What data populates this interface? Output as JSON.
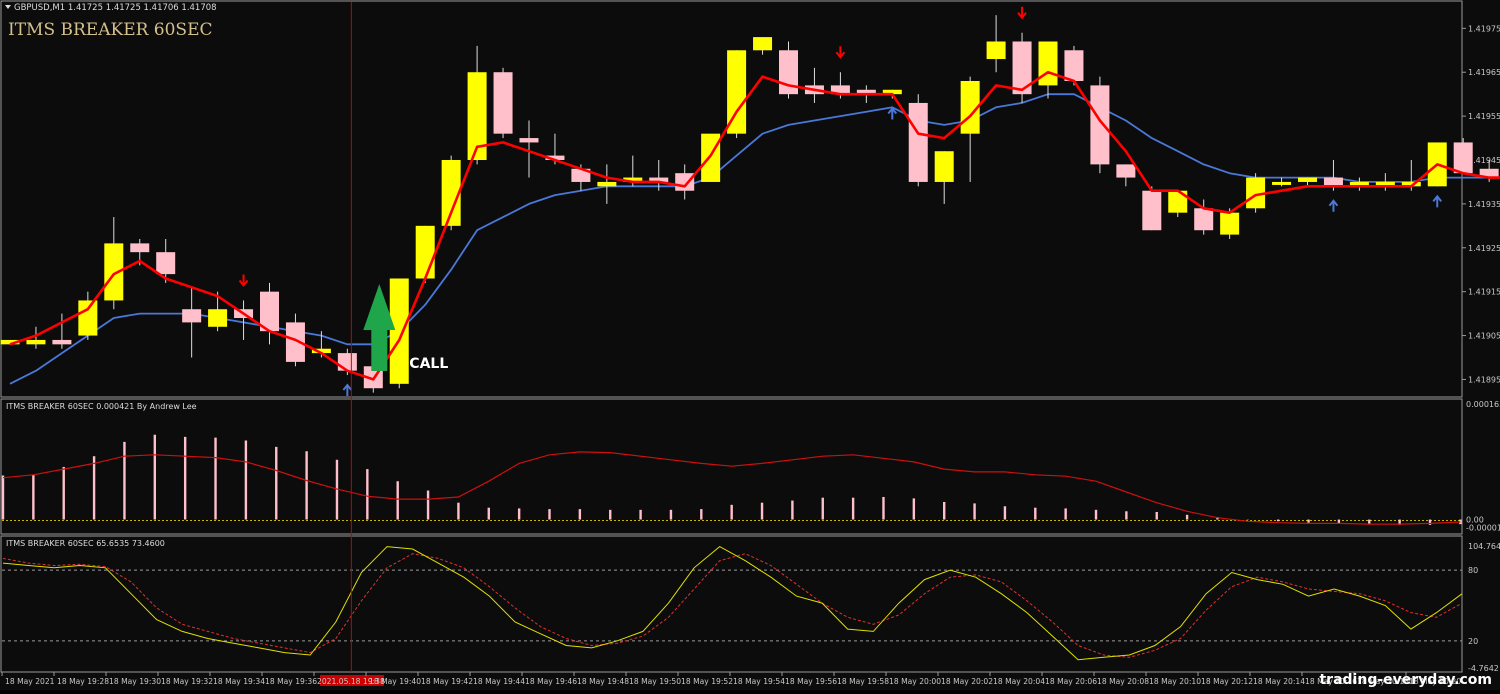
{
  "symbol_header": "GBPUSD,M1  1.41725 1.41725 1.41706 1.41708",
  "indicator_title": "ITMS BREAKER 60SEC",
  "signal_label": "CALL",
  "watermark": "trading-everyday.com",
  "colors": {
    "background": "#0c0c0c",
    "bull_candle": "#ffff00",
    "bear_candle": "#ffc0cb",
    "ma_fast": "#ff0000",
    "ma_slow": "#4a78d8",
    "arrow_up": "#4a78d8",
    "arrow_down": "#ff0000",
    "call_arrow": "#1fa64a",
    "cursor_line": "#cc0000",
    "histogram": "#ffc0cb",
    "histogram_line": "#cc1010",
    "stoch_main": "#e0e000",
    "stoch_signal": "#e03030",
    "axis_text": "#c8c8c8",
    "time_highlight": "#cc0000"
  },
  "price_axis": [
    "1.41975",
    "1.41965",
    "1.41955",
    "1.41945",
    "1.41935",
    "1.41925",
    "1.41915",
    "1.41905",
    "1.41895"
  ],
  "histogram_panel": {
    "label": "ITMS BREAKER 60SEC 0.000421  By Andrew Lee",
    "axis_labels": [
      "0.000163",
      "0.00",
      "-0.000016"
    ]
  },
  "stoch_panel": {
    "label": "ITMS BREAKER 60SEC 65.6535 73.4600",
    "axis_labels": [
      "104.7642",
      "80",
      "20",
      "-4.7642"
    ],
    "levels": [
      80,
      20
    ]
  },
  "time_axis": [
    "18 May 2021",
    "18 May 19:28",
    "18 May 19:30",
    "18 May 19:32",
    "18 May 19:34",
    "18 May 19:36",
    "2021.05.18 19:38",
    "18 May 19:40",
    "18 May 19:42",
    "18 May 19:44",
    "18 May 19:46",
    "18 May 19:48",
    "18 May 19:50",
    "18 May 19:52",
    "18 May 19:54",
    "18 May 19:56",
    "18 May 19:58",
    "18 May 20:00",
    "18 May 20:02",
    "18 May 20:04",
    "18 May 20:06",
    "18 May 20:08",
    "18 May 20:10",
    "18 May 20:12",
    "18 May 20:14",
    "18 May 20:16",
    "18 May 20:18",
    "18 May 20:20"
  ],
  "chart_data": {
    "type": "candlestick",
    "candles": [
      {
        "o": 1.41903,
        "h": 1.41904,
        "l": 1.41903,
        "c": 1.41904
      },
      {
        "o": 1.41903,
        "h": 1.41907,
        "l": 1.41902,
        "c": 1.41904
      },
      {
        "o": 1.41904,
        "h": 1.4191,
        "l": 1.41902,
        "c": 1.41903
      },
      {
        "o": 1.41905,
        "h": 1.41915,
        "l": 1.41904,
        "c": 1.41913
      },
      {
        "o": 1.41913,
        "h": 1.41932,
        "l": 1.41911,
        "c": 1.41926
      },
      {
        "o": 1.41926,
        "h": 1.41927,
        "l": 1.41921,
        "c": 1.41924
      },
      {
        "o": 1.41924,
        "h": 1.41927,
        "l": 1.41917,
        "c": 1.41919
      },
      {
        "o": 1.41911,
        "h": 1.41916,
        "l": 1.419,
        "c": 1.41908
      },
      {
        "o": 1.41907,
        "h": 1.41915,
        "l": 1.41906,
        "c": 1.41911
      },
      {
        "o": 1.41911,
        "h": 1.41913,
        "l": 1.41904,
        "c": 1.41909
      },
      {
        "o": 1.41915,
        "h": 1.41917,
        "l": 1.41903,
        "c": 1.41906
      },
      {
        "o": 1.41908,
        "h": 1.4191,
        "l": 1.41898,
        "c": 1.41899
      },
      {
        "o": 1.41901,
        "h": 1.41906,
        "l": 1.419,
        "c": 1.41902
      },
      {
        "o": 1.41901,
        "h": 1.41902,
        "l": 1.41896,
        "c": 1.41897
      },
      {
        "o": 1.41898,
        "h": 1.41899,
        "l": 1.41892,
        "c": 1.41893
      },
      {
        "o": 1.41894,
        "h": 1.41918,
        "l": 1.41893,
        "c": 1.41918
      },
      {
        "o": 1.41918,
        "h": 1.4193,
        "l": 1.41917,
        "c": 1.4193
      },
      {
        "o": 1.4193,
        "h": 1.41946,
        "l": 1.41929,
        "c": 1.41945
      },
      {
        "o": 1.41945,
        "h": 1.41971,
        "l": 1.41944,
        "c": 1.41965
      },
      {
        "o": 1.41965,
        "h": 1.41966,
        "l": 1.4195,
        "c": 1.41951
      },
      {
        "o": 1.4195,
        "h": 1.41954,
        "l": 1.41941,
        "c": 1.41949
      },
      {
        "o": 1.41946,
        "h": 1.41951,
        "l": 1.41944,
        "c": 1.41945
      },
      {
        "o": 1.41943,
        "h": 1.41944,
        "l": 1.41938,
        "c": 1.4194
      },
      {
        "o": 1.41939,
        "h": 1.41944,
        "l": 1.41935,
        "c": 1.4194
      },
      {
        "o": 1.4194,
        "h": 1.41946,
        "l": 1.41939,
        "c": 1.41941
      },
      {
        "o": 1.41941,
        "h": 1.41945,
        "l": 1.41938,
        "c": 1.4194
      },
      {
        "o": 1.41942,
        "h": 1.41944,
        "l": 1.41936,
        "c": 1.41938
      },
      {
        "o": 1.4194,
        "h": 1.41946,
        "l": 1.4194,
        "c": 1.41951
      },
      {
        "o": 1.41951,
        "h": 1.4197,
        "l": 1.4195,
        "c": 1.4197
      },
      {
        "o": 1.4197,
        "h": 1.41973,
        "l": 1.41969,
        "c": 1.41973
      },
      {
        "o": 1.4197,
        "h": 1.41972,
        "l": 1.41959,
        "c": 1.4196
      },
      {
        "o": 1.41962,
        "h": 1.41966,
        "l": 1.41958,
        "c": 1.4196
      },
      {
        "o": 1.41962,
        "h": 1.41965,
        "l": 1.41959,
        "c": 1.4196
      },
      {
        "o": 1.41961,
        "h": 1.41962,
        "l": 1.41958,
        "c": 1.4196
      },
      {
        "o": 1.4196,
        "h": 1.41961,
        "l": 1.41959,
        "c": 1.41961
      },
      {
        "o": 1.41958,
        "h": 1.4196,
        "l": 1.41939,
        "c": 1.4194
      },
      {
        "o": 1.4194,
        "h": 1.41947,
        "l": 1.41935,
        "c": 1.41947
      },
      {
        "o": 1.41951,
        "h": 1.41964,
        "l": 1.4194,
        "c": 1.41963
      },
      {
        "o": 1.41968,
        "h": 1.41978,
        "l": 1.41965,
        "c": 1.41972
      },
      {
        "o": 1.41972,
        "h": 1.41974,
        "l": 1.41958,
        "c": 1.4196
      },
      {
        "o": 1.41962,
        "h": 1.41972,
        "l": 1.41959,
        "c": 1.41972
      },
      {
        "o": 1.4197,
        "h": 1.41971,
        "l": 1.41962,
        "c": 1.41963
      },
      {
        "o": 1.41962,
        "h": 1.41964,
        "l": 1.41942,
        "c": 1.41944
      },
      {
        "o": 1.41944,
        "h": 1.41944,
        "l": 1.41939,
        "c": 1.41941
      },
      {
        "o": 1.41938,
        "h": 1.41939,
        "l": 1.41929,
        "c": 1.41929
      },
      {
        "o": 1.41933,
        "h": 1.41938,
        "l": 1.41932,
        "c": 1.41938
      },
      {
        "o": 1.41934,
        "h": 1.41936,
        "l": 1.41928,
        "c": 1.41929
      },
      {
        "o": 1.41928,
        "h": 1.41934,
        "l": 1.41927,
        "c": 1.41933
      },
      {
        "o": 1.41934,
        "h": 1.41942,
        "l": 1.41933,
        "c": 1.41941
      },
      {
        "o": 1.4194,
        "h": 1.41941,
        "l": 1.41939,
        "c": 1.4194
      },
      {
        "o": 1.4194,
        "h": 1.41941,
        "l": 1.41939,
        "c": 1.41941
      },
      {
        "o": 1.41941,
        "h": 1.41945,
        "l": 1.41938,
        "c": 1.41939
      },
      {
        "o": 1.41939,
        "h": 1.41941,
        "l": 1.41938,
        "c": 1.4194
      },
      {
        "o": 1.41939,
        "h": 1.41942,
        "l": 1.41938,
        "c": 1.4194
      },
      {
        "o": 1.41939,
        "h": 1.41945,
        "l": 1.41938,
        "c": 1.4194
      },
      {
        "o": 1.41939,
        "h": 1.41949,
        "l": 1.41939,
        "c": 1.41949
      },
      {
        "o": 1.41949,
        "h": 1.4195,
        "l": 1.41942,
        "c": 1.41942
      },
      {
        "o": 1.41943,
        "h": 1.41945,
        "l": 1.4194,
        "c": 1.41941
      },
      {
        "o": 1.41942,
        "h": 1.41946,
        "l": 1.4194,
        "c": 1.41941
      },
      {
        "o": 1.4194,
        "h": 1.4195,
        "l": 1.41939,
        "c": 1.41949
      },
      {
        "o": 1.41947,
        "h": 1.41949,
        "l": 1.41939,
        "c": 1.4194
      }
    ],
    "ma_fast": [
      1.41903,
      1.41905,
      1.41908,
      1.41911,
      1.41919,
      1.41922,
      1.41918,
      1.41916,
      1.41914,
      1.4191,
      1.41906,
      1.41904,
      1.41901,
      1.41897,
      1.41895,
      1.41904,
      1.41918,
      1.41933,
      1.41948,
      1.41949,
      1.41947,
      1.41945,
      1.41943,
      1.41941,
      1.4194,
      1.4194,
      1.41939,
      1.41946,
      1.41956,
      1.41964,
      1.41962,
      1.41961,
      1.4196,
      1.4196,
      1.4196,
      1.41951,
      1.4195,
      1.41955,
      1.41962,
      1.41961,
      1.41965,
      1.41963,
      1.41954,
      1.41947,
      1.41938,
      1.41938,
      1.41934,
      1.41933,
      1.41937,
      1.41938,
      1.41939,
      1.41939,
      1.41939,
      1.41939,
      1.41939,
      1.41944,
      1.41942,
      1.41941,
      1.41941,
      1.41944,
      1.41946
    ],
    "ma_slow": [
      1.41894,
      1.41897,
      1.41901,
      1.41905,
      1.41909,
      1.4191,
      1.4191,
      1.4191,
      1.41909,
      1.41908,
      1.41907,
      1.41906,
      1.41905,
      1.41903,
      1.41903,
      1.41906,
      1.41912,
      1.4192,
      1.41929,
      1.41932,
      1.41935,
      1.41937,
      1.41938,
      1.41939,
      1.41939,
      1.41939,
      1.41939,
      1.41941,
      1.41946,
      1.41951,
      1.41953,
      1.41954,
      1.41955,
      1.41956,
      1.41957,
      1.41954,
      1.41953,
      1.41954,
      1.41957,
      1.41958,
      1.4196,
      1.4196,
      1.41957,
      1.41954,
      1.4195,
      1.41947,
      1.41944,
      1.41942,
      1.41941,
      1.41941,
      1.41941,
      1.41941,
      1.4194,
      1.4194,
      1.4194,
      1.41941,
      1.41941,
      1.41941,
      1.41941,
      1.41942,
      1.41943
    ],
    "arrows": [
      {
        "index": 9,
        "dir": "down"
      },
      {
        "index": 13,
        "dir": "up"
      },
      {
        "index": 32,
        "dir": "down"
      },
      {
        "index": 34,
        "dir": "up"
      },
      {
        "index": 39,
        "dir": "down"
      },
      {
        "index": 51,
        "dir": "up"
      },
      {
        "index": 55,
        "dir": "up"
      }
    ],
    "call_index": 14,
    "cursor_index": 13,
    "histogram": {
      "ylim": [
        -1.6e-05,
        0.000163
      ],
      "bars": [
        6.3e-05,
        6.4e-05,
        7.5e-05,
        9e-05,
        0.00011,
        0.00012,
        0.000117,
        0.000116,
        0.000112,
        0.000103,
        9.7e-05,
        8.5e-05,
        7.2e-05,
        5.5e-05,
        4.2e-05,
        2.5e-05,
        1.8e-05,
        1.7e-05,
        1.6e-05,
        1.6e-05,
        1.5e-05,
        1.5e-05,
        1.5e-05,
        1.6e-05,
        2.2e-05,
        2.5e-05,
        2.8e-05,
        3.2e-05,
        3.2e-05,
        3.3e-05,
        3.1e-05,
        2.6e-05,
        2.4e-05,
        2e-05,
        1.8e-05,
        1.7e-05,
        1.5e-05,
        1.3e-05,
        1.2e-05,
        8e-06,
        5e-06,
        1e-06,
        -1e-06,
        -3e-06,
        -4e-06,
        -5e-06,
        -6e-06,
        -6e-06,
        -5e-06
      ],
      "line": [
        6e-05,
        6.4e-05,
        7.2e-05,
        8e-05,
        9e-05,
        9.2e-05,
        9e-05,
        8.8e-05,
        8.2e-05,
        7e-05,
        5.6e-05,
        4.4e-05,
        3.4e-05,
        3e-05,
        3e-05,
        3.3e-05,
        5.5e-05,
        8e-05,
        9.2e-05,
        9.6e-05,
        9.5e-05,
        9e-05,
        8.5e-05,
        8e-05,
        7.6e-05,
        8e-05,
        8.5e-05,
        9e-05,
        9.2e-05,
        8.7e-05,
        8.2e-05,
        7.2e-05,
        6.8e-05,
        6.8e-05,
        6.4e-05,
        6.2e-05,
        5.5e-05,
        4e-05,
        2.5e-05,
        1.3e-05,
        4e-06,
        -1e-06,
        -3e-06,
        -4e-06,
        -4e-06,
        -5e-06,
        -5e-06,
        -4e-06,
        -2e-06
      ]
    },
    "stoch": {
      "ylim": [
        -4.7642,
        104.7642
      ],
      "main": [
        86,
        84,
        82,
        84,
        82,
        60,
        38,
        28,
        22,
        18,
        14,
        10,
        8,
        36,
        78,
        100,
        98,
        86,
        74,
        58,
        36,
        26,
        16,
        14,
        20,
        28,
        52,
        82,
        100,
        88,
        74,
        58,
        52,
        30,
        28,
        52,
        72,
        80,
        74,
        60,
        44,
        24,
        4,
        6,
        8,
        16,
        32,
        60,
        78,
        72,
        68,
        58,
        64,
        58,
        50,
        30,
        44,
        60
      ],
      "signal": [
        90,
        86,
        84,
        85,
        83,
        70,
        48,
        34,
        28,
        22,
        18,
        14,
        10,
        22,
        54,
        82,
        94,
        90,
        82,
        66,
        48,
        32,
        22,
        16,
        18,
        24,
        40,
        64,
        88,
        94,
        84,
        68,
        52,
        40,
        34,
        42,
        60,
        74,
        76,
        70,
        54,
        36,
        16,
        8,
        6,
        12,
        22,
        46,
        66,
        74,
        70,
        64,
        62,
        60,
        54,
        44,
        40,
        52
      ]
    }
  }
}
